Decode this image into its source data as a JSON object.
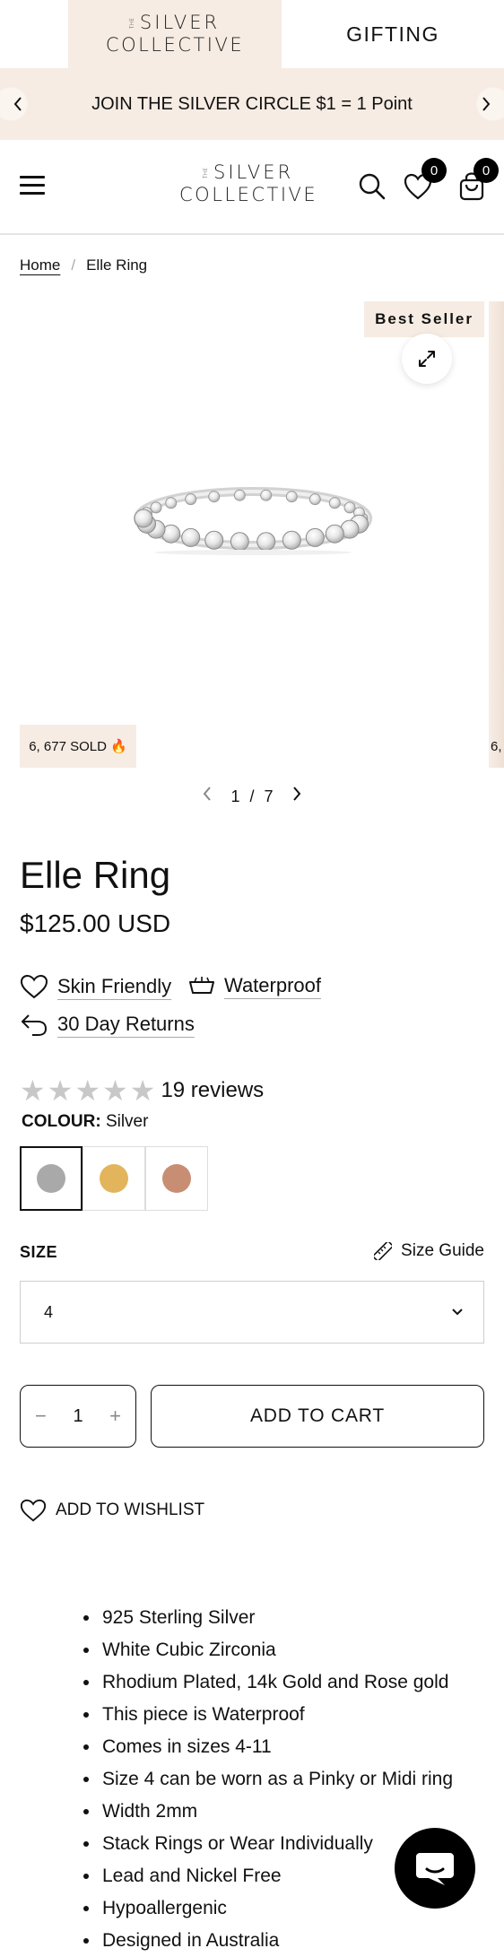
{
  "top_tabs": {
    "brand": {
      "the": "THE",
      "line1": "SILVER",
      "line2": "COLLECTIVE"
    },
    "gifting": "GIFTING"
  },
  "announcement": {
    "text": "JOIN THE SILVER CIRCLE $1 = 1 Point",
    "prev_icon": "chevron-left-icon",
    "next_icon": "chevron-right-icon"
  },
  "header": {
    "logo": {
      "the": "THE",
      "line1": "SILVER",
      "line2": "COLLECTIVE"
    },
    "wishlist_count": "0",
    "cart_count": "0"
  },
  "breadcrumb": {
    "home": "Home",
    "separator": "/",
    "current": "Elle Ring"
  },
  "gallery": {
    "badge": "Best Seller",
    "sold": "6, 677 SOLD 🔥",
    "next_slide_sold": "6,",
    "current": "1",
    "separator": "/",
    "total": "7"
  },
  "product": {
    "title": "Elle Ring",
    "price": "$125.00 USD",
    "features": [
      "Skin Friendly",
      "Waterproof",
      "30 Day Returns"
    ],
    "rating": 0,
    "reviews": "19 reviews",
    "colour_label": "COLOUR:",
    "colour_value": "Silver",
    "swatches": [
      {
        "name": "Silver",
        "color": "#a9a9a9",
        "selected": true
      },
      {
        "name": "Gold",
        "color": "#e2b55c",
        "selected": false
      },
      {
        "name": "Rose Gold",
        "color": "#c88e74",
        "selected": false
      }
    ],
    "size_label": "SIZE",
    "size_guide": "Size Guide",
    "size_value": "4",
    "quantity": "1",
    "add_to_cart": "ADD TO CART",
    "add_to_wishlist": "ADD TO WISHLIST",
    "details": [
      "925 Sterling Silver",
      "White Cubic Zirconia",
      "Rhodium Plated, 14k Gold and Rose gold",
      "This piece is Waterproof",
      "Comes in sizes 4-11",
      "Size 4 can be worn as a Pinky or Midi ring",
      "Width 2mm",
      "Stack Rings or Wear Individually",
      "Lead and Nickel Free",
      "Hypoallergenic",
      "Designed in Australia"
    ]
  },
  "colors": {
    "accent_bg": "#f6ece3",
    "text": "#111111"
  }
}
